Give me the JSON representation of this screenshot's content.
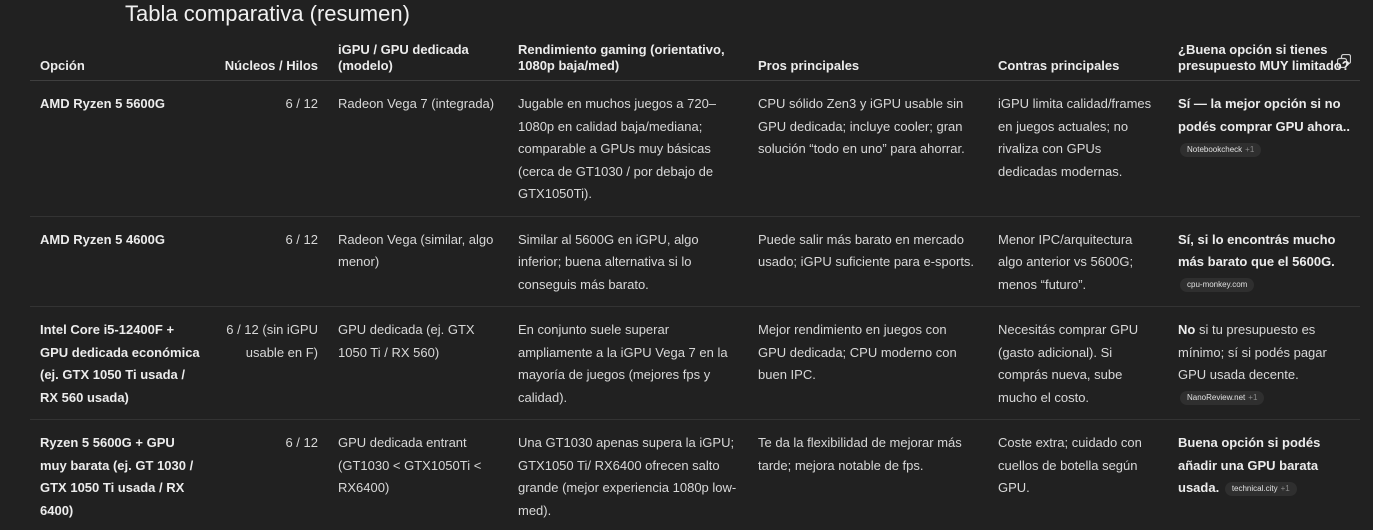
{
  "title": "Tabla comparativa (resumen)",
  "icons": {
    "copy": "copy-icon"
  },
  "columns": [
    "Opción",
    "Núcleos / Hilos",
    "iGPU / GPU dedicada (modelo)",
    "Rendimiento gaming (orientativo, 1080p baja/med)",
    "Pros principales",
    "Contras principales",
    "¿Buena opción si tienes presupuesto MUY limitado?"
  ],
  "rows": [
    {
      "option": "AMD Ryzen 5 5600G",
      "cores": "6 / 12",
      "gpu": "Radeon Vega 7 (integrada)",
      "gaming": "Jugable en muchos juegos a 720–1080p en calidad baja/mediana; comparable a GPUs muy básicas (cerca de GT1030 / por debajo de GTX1050Ti).",
      "pros": "CPU sólido Zen3 y iGPU usable sin GPU dedicada; incluye cooler; gran solución “todo en uno” para ahorrar.",
      "cons": "iGPU limita calidad/frames en juegos actuales; no rivaliza con GPUs dedicadas modernas.",
      "verdict": "Sí — la mejor opción si no podés comprar GPU ahora..",
      "source": "Notebookcheck",
      "source_extra": "+1"
    },
    {
      "option": "AMD Ryzen 5 4600G",
      "cores": "6 / 12",
      "gpu": "Radeon Vega (similar, algo menor)",
      "gaming": "Similar al 5600G en iGPU, algo inferior; buena alternativa si lo conseguis más barato.",
      "pros": "Puede salir más barato en mercado usado; iGPU suficiente para e-sports.",
      "cons": "Menor IPC/arquitectura algo anterior vs 5600G; menos “futuro”.",
      "verdict": "Sí, si lo encontrás mucho más barato que el 5600G.",
      "source": "cpu-monkey.com",
      "source_extra": ""
    },
    {
      "option": "Intel Core i5-12400F + GPU dedicada económica (ej. GTX 1050 Ti usada / RX 560 usada)",
      "cores": "6 / 12 (sin iGPU usable en F)",
      "gpu": "GPU dedicada (ej. GTX 1050 Ti / RX 560)",
      "gaming": "En conjunto suele superar ampliamente a la iGPU Vega 7 en la mayoría de juegos (mejores fps y calidad).",
      "pros": "Mejor rendimiento en juegos con GPU dedicada; CPU moderno con buen IPC.",
      "cons": "Necesitás comprar GPU (gasto adicional). Si comprás nueva, sube mucho el costo.",
      "verdict_bold": "No",
      "verdict": " si tu presupuesto es mínimo; sí si podés pagar GPU usada decente.",
      "source": "NanoReview.net",
      "source_extra": "+1"
    },
    {
      "option": "Ryzen 5 5600G + GPU muy barata (ej. GT 1030 / GTX 1050 Ti usada / RX 6400)",
      "cores": "6 / 12",
      "gpu": "GPU dedicada entrant (GT1030 < GTX1050Ti < RX6400)",
      "gaming": "Una GT1030 apenas supera la iGPU; GTX1050 Ti/ RX6400 ofrecen salto grande (mejor experiencia 1080p low-med).",
      "pros": "Te da la flexibilidad de mejorar más tarde; mejora notable de fps.",
      "cons": "Coste extra; cuidado con cuellos de botella según GPU.",
      "verdict": "Buena opción si podés añadir una GPU barata usada.",
      "source": "technical.city",
      "source_extra": "+1"
    }
  ]
}
